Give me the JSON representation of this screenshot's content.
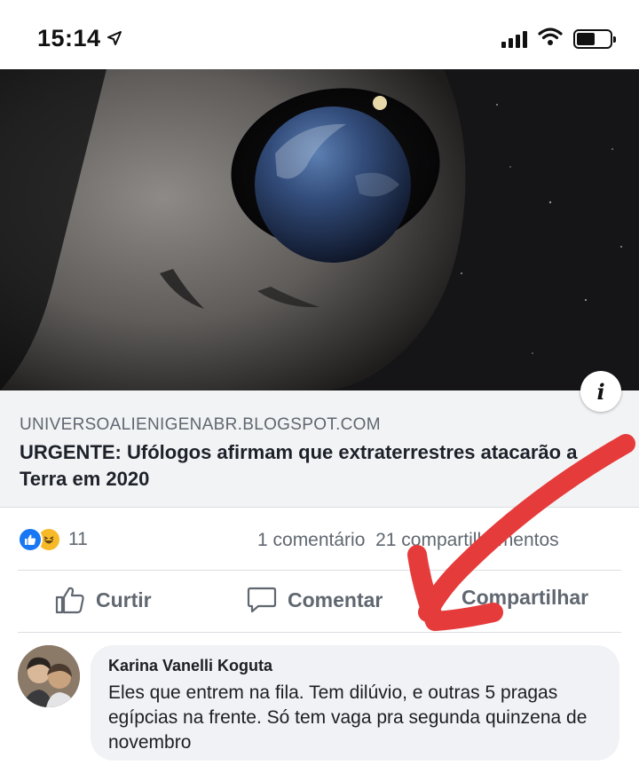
{
  "status_bar": {
    "time": "15:14",
    "location_icon": "location-arrow-icon",
    "signal_icon": "cellular-signal-icon",
    "wifi_icon": "wifi-icon",
    "battery_icon": "battery-icon"
  },
  "post": {
    "link_preview": {
      "domain": "UNIVERSOALIENIGENABR.BLOGSPOT.COM",
      "title": "URGENTE: Ufólogos afirmam que extraterrestres atacarão a Terra em 2020",
      "info_label": "i"
    },
    "reactions": {
      "count": "11",
      "types": [
        "like",
        "haha"
      ]
    },
    "stats": {
      "comments": "1 comentário",
      "shares": "21 compartilhamentos"
    },
    "actions": {
      "like": "Curtir",
      "comment": "Comentar",
      "share": "Compartilhar"
    }
  },
  "comment": {
    "author": "Karina Vanelli Koguta",
    "text": "Eles que entrem na fila. Tem  dilúvio, e outras 5 pragas egípcias na frente. Só tem vaga pra segunda quinzena de novembro"
  },
  "colors": {
    "facebook_blue": "#1877f2",
    "haha_yellow": "#f7b928",
    "arrow_red": "#e63b3b",
    "secondary_text": "#606770"
  }
}
